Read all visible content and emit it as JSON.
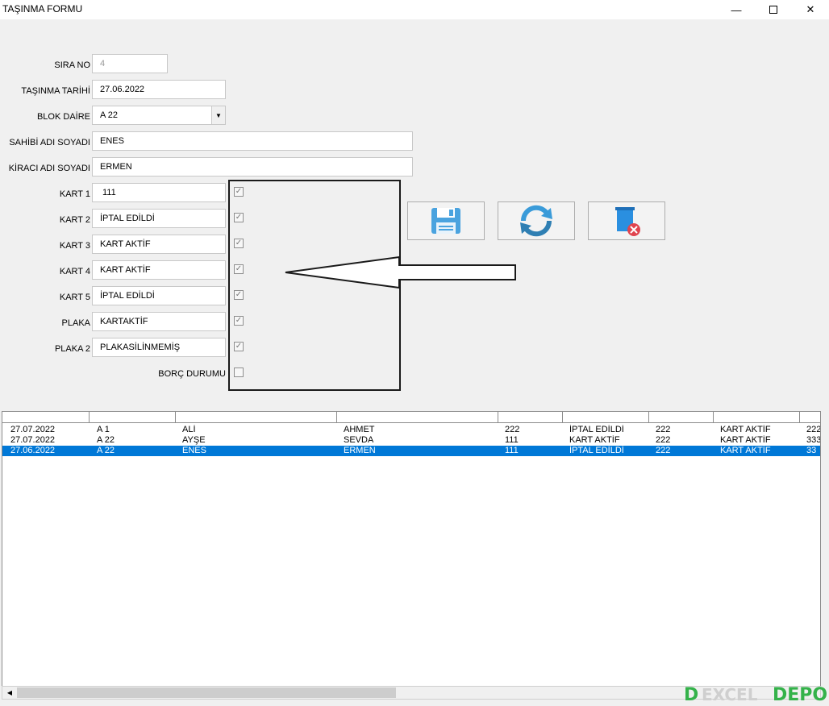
{
  "window": {
    "title": "TAŞINMA FORMU",
    "minimize": "—",
    "close": "✕"
  },
  "form": {
    "sira_no": {
      "label": "SIRA NO",
      "value": "4"
    },
    "tasinma_tarihi": {
      "label": "TAŞINMA TARİHİ",
      "value": "27.06.2022"
    },
    "blok_daire": {
      "label": "BLOK DAİRE",
      "value": "A 22"
    },
    "sahibi": {
      "label": "SAHİBİ ADI SOYADI",
      "value": "ENES"
    },
    "kiraci": {
      "label": "KİRACI ADI SOYADI",
      "value": "ERMEN"
    },
    "kart1": {
      "label": "KART 1",
      "value": "111",
      "checked": true
    },
    "kart2": {
      "label": "KART 2",
      "value": "İPTAL EDİLDİ",
      "checked": true
    },
    "kart3": {
      "label": "KART 3",
      "value": "KART AKTİF",
      "checked": true
    },
    "kart4": {
      "label": "KART 4",
      "value": "KART AKTİF",
      "checked": true
    },
    "kart5": {
      "label": "KART 5",
      "value": "İPTAL EDİLDİ",
      "checked": true
    },
    "plaka": {
      "label": "PLAKA",
      "value": "KARTAKTİF",
      "checked": true
    },
    "plaka2": {
      "label": "PLAKA 2",
      "value": "PLAKASİLİNMEMİŞ",
      "checked": true
    },
    "borc": {
      "label": "BORÇ DURUMU",
      "checked": false
    },
    "check_mark": "✓"
  },
  "toolbar": {
    "save_icon": "floppy-disk-icon",
    "refresh_icon": "refresh-icon",
    "delete_icon": "delete-bin-icon"
  },
  "grid": {
    "rows": [
      [
        "27.07.2022",
        "A 1",
        "ALİ",
        "AHMET",
        "222",
        "İPTAL EDİLDİ",
        "222",
        "KART AKTİF",
        "222"
      ],
      [
        "27.07.2022",
        "A 22",
        "AYŞE",
        "SEVDA",
        "111",
        "KART AKTİF",
        "222",
        "KART AKTİF",
        "333"
      ],
      [
        "27.06.2022",
        "A 22",
        "ENES",
        "ERMEN",
        "111",
        "İPTAL EDİLDİ",
        "222",
        "KART AKTİF",
        "33"
      ]
    ],
    "selected_row": 2
  },
  "scrollbar": {
    "left_arrow": "◀",
    "right_arrow": "▶"
  },
  "logo": {
    "c": "D",
    "mid": "EXCEL",
    "depo": "DEPO"
  },
  "colors": {
    "selection": "#0078d7",
    "logo_green": "#34b24a"
  }
}
